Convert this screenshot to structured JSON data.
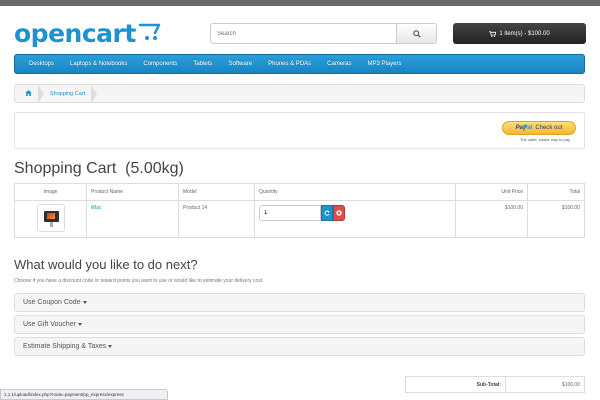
{
  "header": {
    "logo_text": "opencart",
    "search_placeholder": "Search",
    "cart_button_label": "1 item(s) - $100.00"
  },
  "menu": {
    "items": [
      "Desktops",
      "Laptops & Notebooks",
      "Components",
      "Tablets",
      "Software",
      "Phones & PDAs",
      "Cameras",
      "MP3 Players"
    ]
  },
  "breadcrumb": {
    "current": "Shopping Cart"
  },
  "paypal": {
    "brand_part1": "Pay",
    "brand_part2": "Pal",
    "button_label": "Check out",
    "tagline": "The safer, easier way to pay"
  },
  "page": {
    "title": "Shopping Cart  (5.00kg)"
  },
  "cart_table": {
    "headers": [
      "Image",
      "Product Name",
      "Model",
      "Quantity",
      "Unit Price",
      "Total"
    ],
    "rows": [
      {
        "name": "iMac",
        "model": "Product 14",
        "quantity": "1",
        "unit_price": "$100.00",
        "total": "$100.00"
      }
    ]
  },
  "next": {
    "title": "What would you like to do next?",
    "description": "Choose if you have a discount code or reward points you want to use or would like to estimate your delivery cost.",
    "panels": [
      "Use Coupon Code",
      "Use Gift Voucher",
      "Estimate Shipping & Taxes"
    ]
  },
  "totals": {
    "subtotal_label": "Sub-Total:",
    "subtotal_value": "$100.00"
  },
  "status_bar": {
    "url": "1.1.1/upload/index.php?route=payment/pp_express/express"
  },
  "colors": {
    "brand": "#1e91cf",
    "menu_bg": "#229ac8",
    "cart_button": "#333333",
    "remove_button": "#da4f49"
  },
  "icons": {
    "logo_cart": "cart-icon",
    "search": "search-icon",
    "cart": "shopping-cart-icon",
    "home": "home-icon",
    "update": "refresh-icon",
    "remove": "times-circle-icon"
  }
}
